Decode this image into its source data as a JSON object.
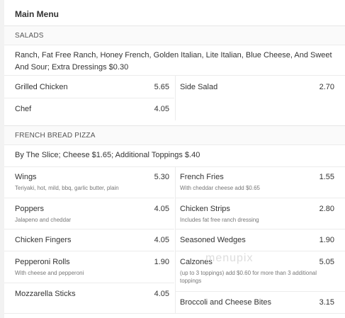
{
  "menu_title": "Main Menu",
  "watermark": "menupix",
  "salads": {
    "heading": "SALADS",
    "description": "Ranch, Fat Free Ranch, Honey French, Golden Italian, Lite Italian, Blue Cheese, And Sweet And Sour; Extra Dressings $0.30",
    "items": [
      {
        "name": "Grilled Chicken",
        "price": "5.65",
        "note": ""
      },
      {
        "name": "Side Salad",
        "price": "2.70",
        "note": ""
      },
      {
        "name": "Chef",
        "price": "4.05",
        "note": ""
      }
    ]
  },
  "pizza": {
    "heading": "FRENCH BREAD PIZZA",
    "description": "By The Slice; Cheese $1.65; Additional Toppings $.40",
    "left": [
      {
        "name": "Wings",
        "price": "5.30",
        "note": "Teriyaki, hot, mild, bbq, garlic butter, plain"
      },
      {
        "name": "Poppers",
        "price": "4.05",
        "note": "Jalapeno and cheddar"
      },
      {
        "name": "Chicken Fingers",
        "price": "4.05",
        "note": ""
      },
      {
        "name": "Pepperoni Rolls",
        "price": "1.90",
        "note": "With cheese and pepperoni"
      },
      {
        "name": "Mozzarella Sticks",
        "price": "4.05",
        "note": ""
      }
    ],
    "right": [
      {
        "name": "French Fries",
        "price": "1.55",
        "note": "With cheddar cheese add $0.65"
      },
      {
        "name": "Chicken Strips",
        "price": "2.80",
        "note": "Includes fat free ranch dressing"
      },
      {
        "name": "Seasoned Wedges",
        "price": "1.90",
        "note": ""
      },
      {
        "name": "Calzones",
        "price": "5.05",
        "note": "(up to 3 toppings) add $0.60 for more than 3 additional toppings"
      },
      {
        "name": "Broccoli and Cheese Bites",
        "price": "3.15",
        "note": ""
      }
    ]
  }
}
